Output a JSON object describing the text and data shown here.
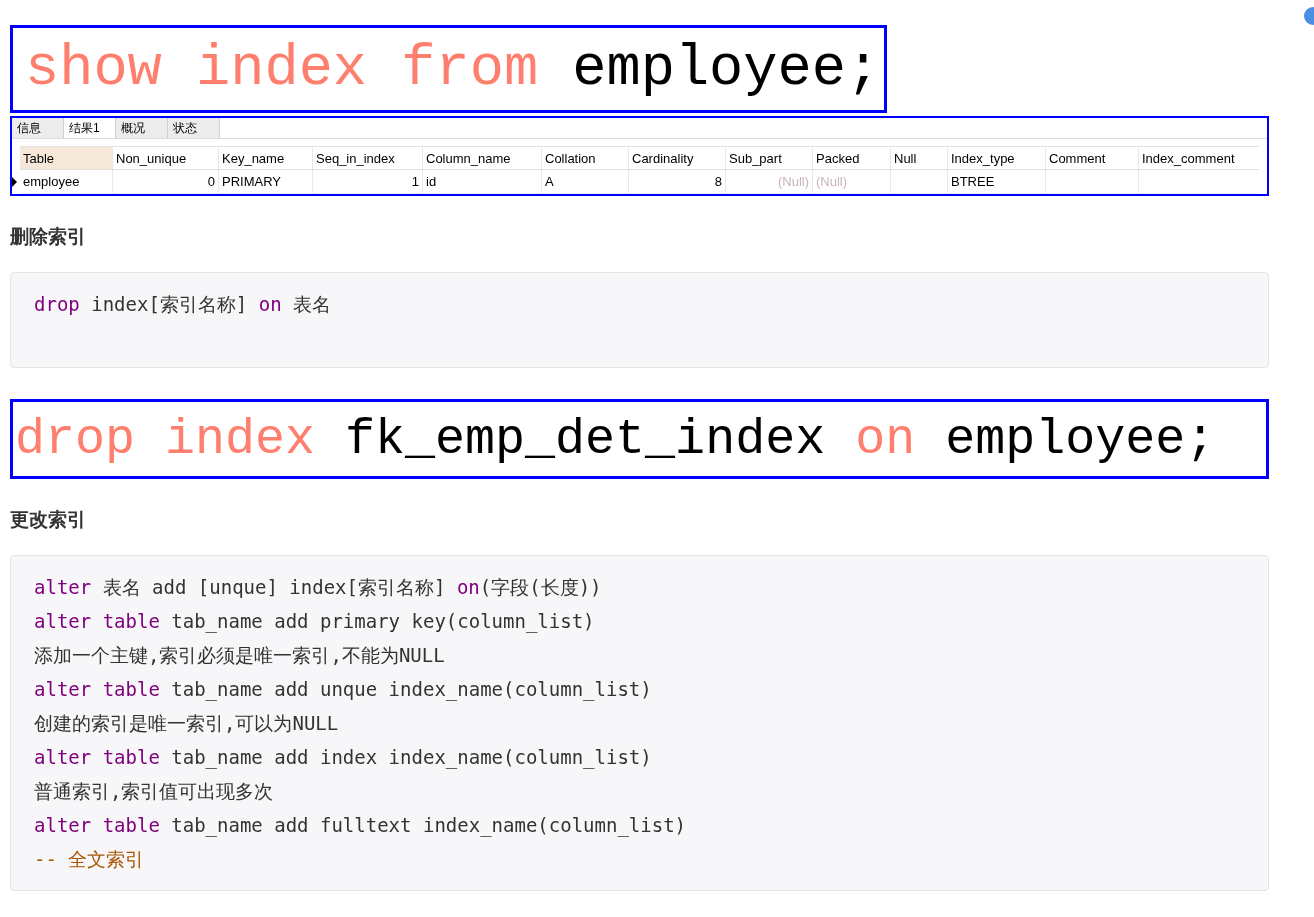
{
  "blocks": [
    {
      "kind": "sql_image",
      "tokens": [
        {
          "kind": "keyword",
          "text": "show index from"
        },
        {
          "kind": "plain",
          "text": " employee;"
        }
      ]
    },
    {
      "kind": "result_table",
      "tabs": [
        {
          "label": "信息",
          "selected": false
        },
        {
          "label": "结果1",
          "selected": true
        },
        {
          "label": "概况",
          "selected": false
        },
        {
          "label": "状态",
          "selected": false
        }
      ],
      "columns": [
        {
          "label": "Table",
          "selected": true
        },
        {
          "label": "Non_unique",
          "selected": false
        },
        {
          "label": "Key_name",
          "selected": false
        },
        {
          "label": "Seq_in_index",
          "selected": false
        },
        {
          "label": "Column_name",
          "selected": false
        },
        {
          "label": "Collation",
          "selected": false
        },
        {
          "label": "Cardinality",
          "selected": false
        },
        {
          "label": "Sub_part",
          "selected": false
        },
        {
          "label": "Packed",
          "selected": false
        },
        {
          "label": "Null",
          "selected": false
        },
        {
          "label": "Index_type",
          "selected": false
        },
        {
          "label": "Comment",
          "selected": false
        },
        {
          "label": "Index_comment",
          "selected": false
        }
      ],
      "rows": [
        {
          "current": true,
          "cells": [
            {
              "kind": "text",
              "text": "employee"
            },
            {
              "kind": "number",
              "text": "0"
            },
            {
              "kind": "text",
              "text": "PRIMARY"
            },
            {
              "kind": "number",
              "text": "1"
            },
            {
              "kind": "text",
              "text": "id"
            },
            {
              "kind": "text",
              "text": "A"
            },
            {
              "kind": "number",
              "text": "8"
            },
            {
              "kind": "null",
              "text": "(Null)"
            },
            {
              "kind": "null_left",
              "text": "(Null)"
            },
            {
              "kind": "empty",
              "text": ""
            },
            {
              "kind": "text",
              "text": "BTREE"
            },
            {
              "kind": "empty",
              "text": ""
            },
            {
              "kind": "empty",
              "text": ""
            }
          ]
        }
      ]
    },
    {
      "kind": "heading",
      "text": "删除索引"
    },
    {
      "kind": "code_block",
      "lines": [
        [
          {
            "kind": "keyword",
            "text": "drop"
          },
          {
            "kind": "plain",
            "text": " index[索引名称] "
          },
          {
            "kind": "keyword",
            "text": "on"
          },
          {
            "kind": "plain",
            "text": " 表名"
          }
        ]
      ]
    },
    {
      "kind": "sql_image",
      "tokens": [
        {
          "kind": "keyword",
          "text": "drop index"
        },
        {
          "kind": "plain",
          "text": " fk_emp_det_index "
        },
        {
          "kind": "keyword",
          "text": "on"
        },
        {
          "kind": "plain",
          "text": " employee;"
        }
      ]
    },
    {
      "kind": "heading",
      "text": "更改索引"
    },
    {
      "kind": "code_block",
      "lines": [
        [
          {
            "kind": "keyword",
            "text": "alter"
          },
          {
            "kind": "plain",
            "text": " 表名 add [unque] index[索引名称] "
          },
          {
            "kind": "keyword",
            "text": "on"
          },
          {
            "kind": "plain",
            "text": "(字段(长度))"
          }
        ],
        [
          {
            "kind": "keyword",
            "text": "alter table"
          },
          {
            "kind": "plain",
            "text": " tab_name add primary key(column_list)"
          }
        ],
        [
          {
            "kind": "plain",
            "text": "添加一个主键,索引必须是唯一索引,不能为NULL"
          }
        ],
        [
          {
            "kind": "keyword",
            "text": "alter table"
          },
          {
            "kind": "plain",
            "text": " tab_name add unque index_name(column_list)"
          }
        ],
        [
          {
            "kind": "plain",
            "text": "创建的索引是唯一索引,可以为NULL"
          }
        ],
        [
          {
            "kind": "keyword",
            "text": "alter table"
          },
          {
            "kind": "plain",
            "text": " tab_name add index index_name(column_list)"
          }
        ],
        [
          {
            "kind": "plain",
            "text": "普通索引,索引值可出现多次"
          }
        ],
        [
          {
            "kind": "keyword",
            "text": "alter table"
          },
          {
            "kind": "plain",
            "text": " tab_name add fulltext index_name(column_list)"
          }
        ],
        [
          {
            "kind": "comment",
            "text": "-- 全文索引"
          }
        ]
      ]
    }
  ]
}
